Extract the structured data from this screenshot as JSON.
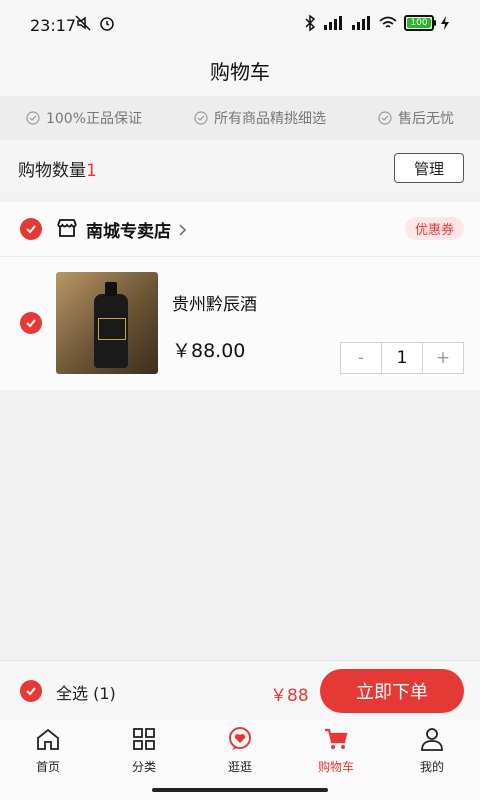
{
  "status": {
    "time": "23:17",
    "battery": "100",
    "icons": [
      "mute-icon",
      "alarm-icon",
      "bluetooth-icon",
      "signal-hd-icon",
      "signal-hd-icon",
      "wifi-icon",
      "battery-icon",
      "charging-icon"
    ]
  },
  "header": {
    "title": "购物车"
  },
  "guarantees": [
    {
      "label": "100%正品保证",
      "icon": "check-circle-icon"
    },
    {
      "label": "所有商品精挑细选",
      "icon": "check-circle-icon"
    },
    {
      "label": "售后无忧",
      "icon": "check-circle-icon"
    }
  ],
  "cart": {
    "count_label": "购物数量",
    "count": "1",
    "manage_label": "管理"
  },
  "store": {
    "name": "南城专卖店",
    "coupon_label": "优惠券",
    "items": [
      {
        "name": "贵州黔辰酒",
        "price": "￥88.00",
        "quantity": "1",
        "minus": "-",
        "plus": "+"
      }
    ]
  },
  "checkout": {
    "select_all_label": "全选 (1)",
    "total": "￥88",
    "order_label": "立即下单"
  },
  "tabs": [
    {
      "label": "首页",
      "icon": "home-icon"
    },
    {
      "label": "分类",
      "icon": "grid-icon"
    },
    {
      "label": "逛逛",
      "icon": "heart-bubble-icon"
    },
    {
      "label": "购物车",
      "icon": "cart-icon",
      "active": true
    },
    {
      "label": "我的",
      "icon": "user-icon"
    }
  ],
  "colors": {
    "accent": "#e53935",
    "background": "#f1f1f1"
  }
}
